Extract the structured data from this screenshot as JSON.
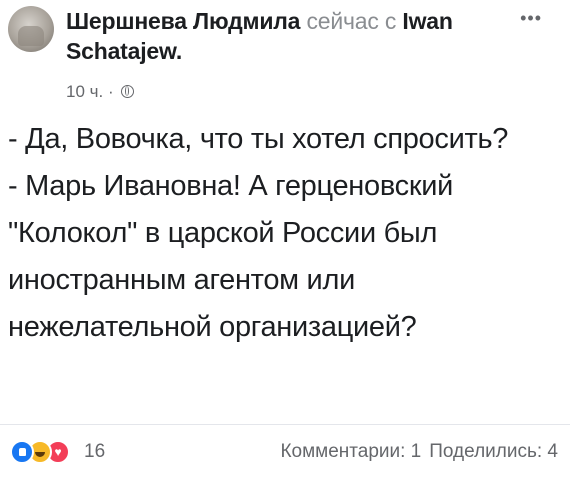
{
  "post": {
    "author": "Шершнева Людмила",
    "tag_prefix": "сейчас с",
    "tagged_user": "Iwan Schatajew",
    "tag_suffix": ".",
    "time": "10 ч.",
    "meta_separator": "·",
    "privacy_icon": "globe-icon",
    "more_icon": "more-dots-icon",
    "text_lines": [
      "- Да, Вовочка, что ты хотел спросить?",
      "- Марь Ивановна! А герценовский \"Колокол\" в царской России был иностранным агентом или нежелательной организацией?"
    ]
  },
  "footer": {
    "reaction_icons": [
      "like-icon",
      "haha-icon",
      "love-icon"
    ],
    "reaction_count": "16",
    "comments": "Комментарии: 1",
    "shares": "Поделились: 4"
  },
  "colors": {
    "text": "#1c1e21",
    "muted": "#65676b",
    "like": "#1877f2",
    "haha": "#f7b928",
    "love": "#f33e58",
    "divider": "#e4e6eb"
  }
}
